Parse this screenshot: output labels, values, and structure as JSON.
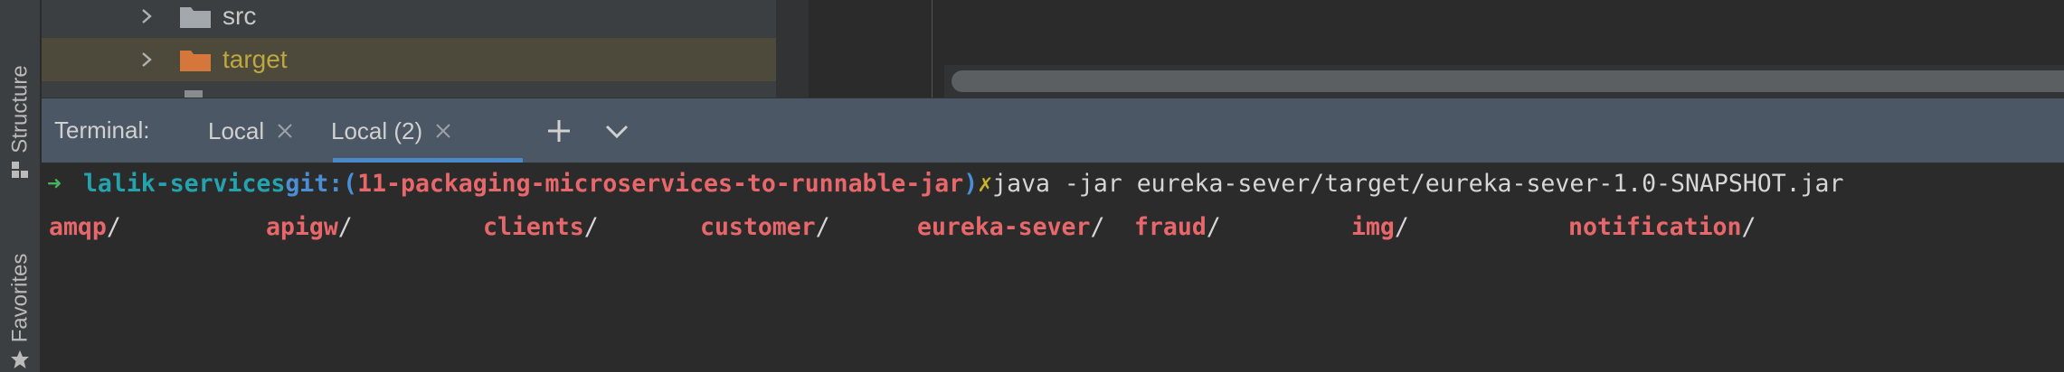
{
  "side_strip": {
    "structure_label": "Structure",
    "favorites_label": "Favorites"
  },
  "project_tree": {
    "items": [
      {
        "label": "src",
        "color": "#c8c8c8",
        "folder_color": "#a3a8ad",
        "selected": false
      },
      {
        "label": "target",
        "color": "#bca83d",
        "folder_color": "#d5763a",
        "selected": true
      }
    ]
  },
  "terminal": {
    "title": "Terminal:",
    "tabs": [
      {
        "label": "Local",
        "active": false
      },
      {
        "label": "Local (2)",
        "active": true
      }
    ],
    "prompt": {
      "arrow": "➜",
      "directory": "lalik-services",
      "git_label": "git:(",
      "branch": "11-packaging-microservices-to-runnable-jar",
      "git_close": ")",
      "dirty_mark": "✗",
      "command": "java -jar eureka-sever/target/eureka-sever-1.0-SNAPSHOT.jar"
    },
    "listing": [
      {
        "name": "amqp",
        "slash": "/"
      },
      {
        "name": "apigw",
        "slash": "/"
      },
      {
        "name": "clients",
        "slash": "/"
      },
      {
        "name": "customer",
        "slash": "/"
      },
      {
        "name": "eureka-sever",
        "slash": "/"
      },
      {
        "name": "fraud",
        "slash": "/"
      },
      {
        "name": "img",
        "slash": "/"
      },
      {
        "name": "notification",
        "slash": "/"
      }
    ]
  },
  "colors": {
    "accent": "#4a88c7",
    "terminal_header": "#4b5764",
    "directory_listing": "#e8676b"
  }
}
